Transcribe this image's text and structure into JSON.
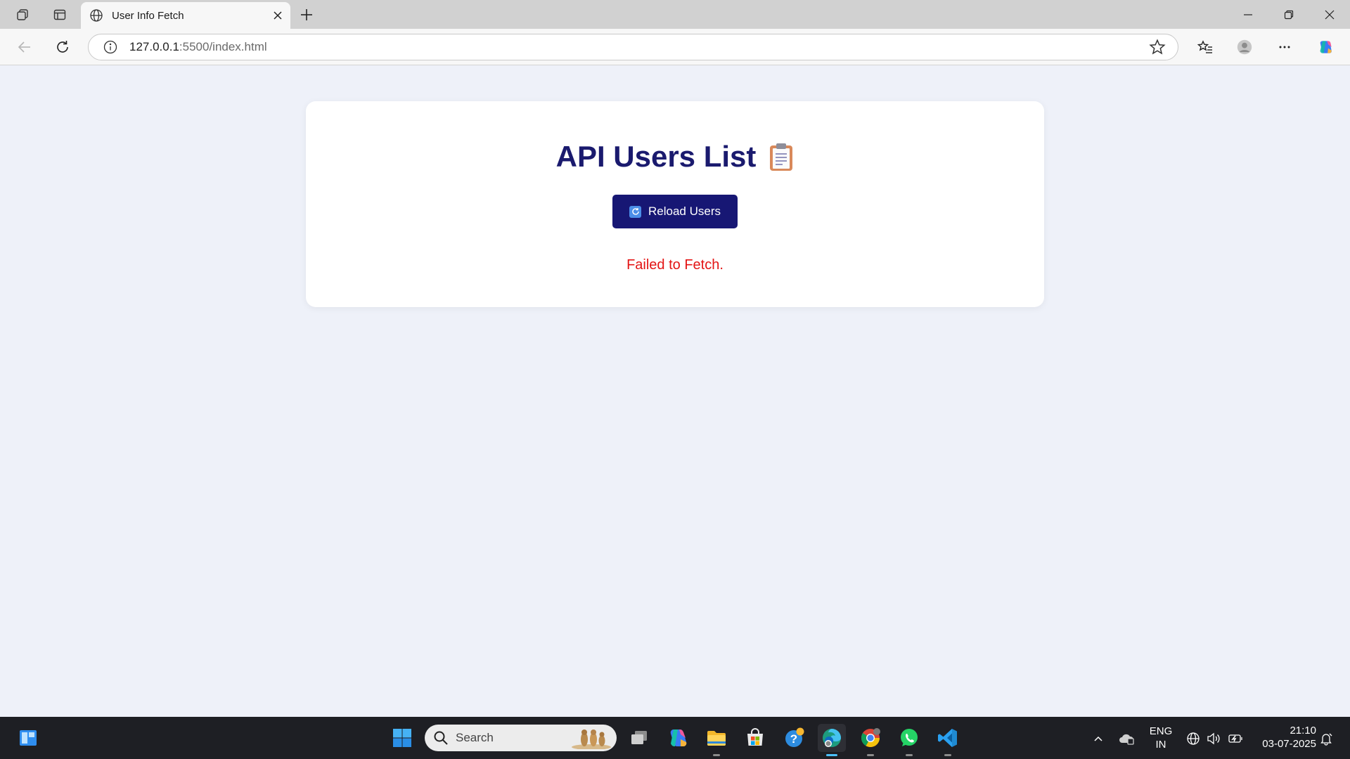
{
  "browser": {
    "tab_title": "User Info Fetch",
    "url_host": "127.0.0.1",
    "url_path": ":5500/index.html"
  },
  "page": {
    "title": "API Users List",
    "title_icon": "clipboard-icon",
    "reload_label": "Reload Users",
    "reload_icon": "refresh-emoji-icon",
    "error_message": "Failed to Fetch.",
    "colors": {
      "title": "#1a1a6e",
      "button": "#171774",
      "error": "#e31414",
      "background": "#eef1f9"
    }
  },
  "taskbar": {
    "search_placeholder": "Search",
    "language_line1": "ENG",
    "language_line2": "IN",
    "time": "21:10",
    "date": "03-07-2025",
    "pinned_apps": [
      "task-view",
      "copilot",
      "file-explorer",
      "microsoft-store",
      "help",
      "edge",
      "chrome",
      "whatsapp",
      "vscode"
    ]
  }
}
